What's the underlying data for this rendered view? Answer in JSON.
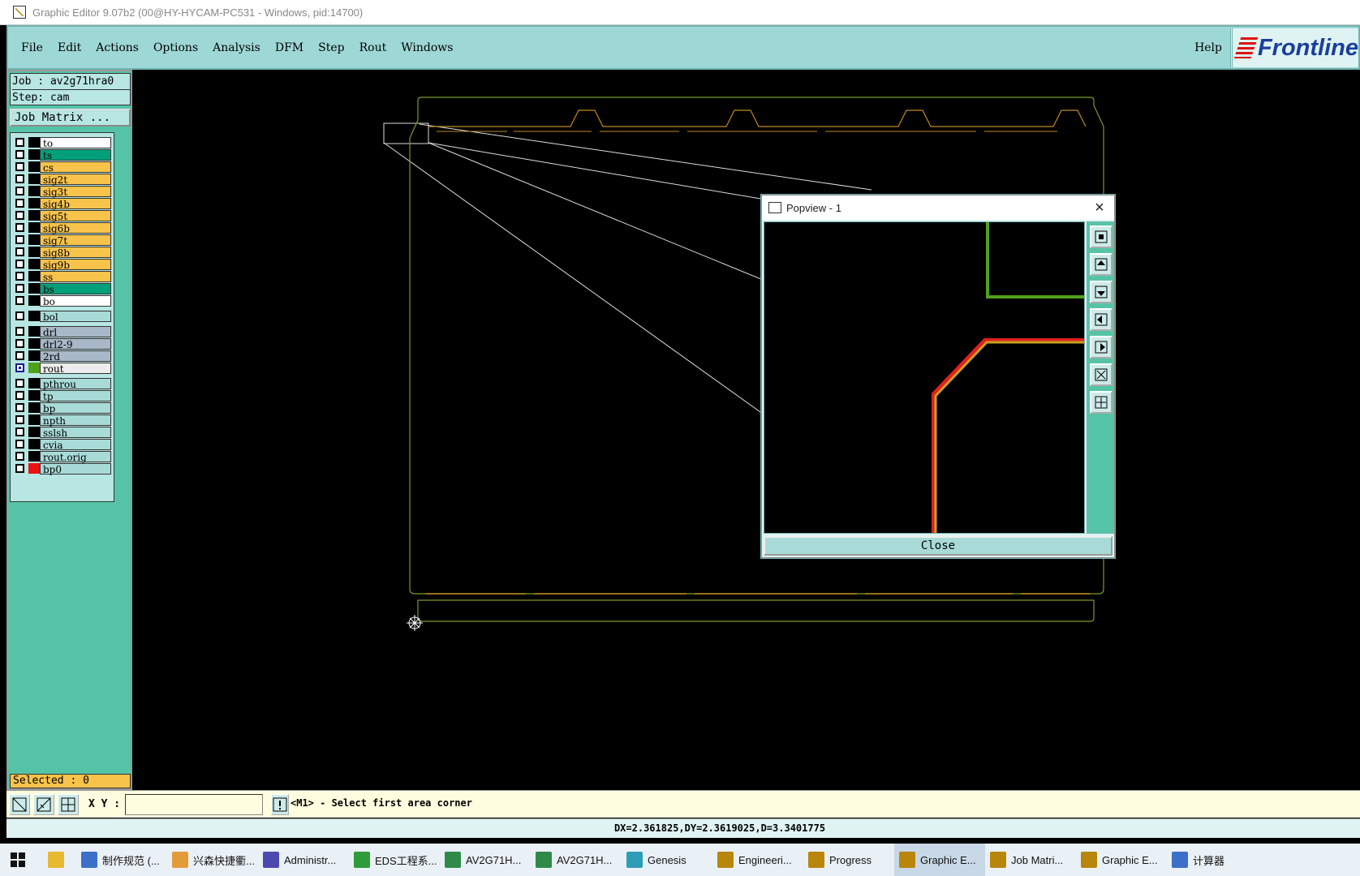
{
  "window": {
    "title": "Graphic Editor 9.07b2 (00@HY-HYCAM-PC531 - Windows, pid:14700)"
  },
  "menu": {
    "items": [
      "File",
      "Edit",
      "Actions",
      "Options",
      "Analysis",
      "DFM",
      "Step",
      "Rout",
      "Windows"
    ],
    "help": "Help",
    "logo": "Frontline"
  },
  "job": {
    "job_line": "Job : av2g71hra0",
    "step_line": "Step: cam",
    "matrix_button": "Job Matrix ..."
  },
  "layers": [
    {
      "name": "to",
      "color": "#ffffff"
    },
    {
      "name": "ts",
      "color": "#00a07a"
    },
    {
      "name": "cs",
      "color": "#f8c34a"
    },
    {
      "name": "sig2t",
      "color": "#f8c34a"
    },
    {
      "name": "sig3t",
      "color": "#f8c34a"
    },
    {
      "name": "sig4b",
      "color": "#f8c34a"
    },
    {
      "name": "sig5t",
      "color": "#f8c34a"
    },
    {
      "name": "sig6b",
      "color": "#f8c34a"
    },
    {
      "name": "sig7t",
      "color": "#f8c34a"
    },
    {
      "name": "sig8b",
      "color": "#f8c34a"
    },
    {
      "name": "sig9b",
      "color": "#f8c34a"
    },
    {
      "name": "ss",
      "color": "#f8c34a"
    },
    {
      "name": "bs",
      "color": "#00a07a"
    },
    {
      "name": "bo",
      "color": "#ffffff"
    },
    {
      "name": "bol",
      "color": "#a8dbd8"
    },
    {
      "name": "drl",
      "color": "#a8b8c8"
    },
    {
      "name": "drl2-9",
      "color": "#a8b8c8"
    },
    {
      "name": "2rd",
      "color": "#a8b8c8"
    },
    {
      "name": "rout",
      "color": "#ececec",
      "active": true,
      "swatch": "#4fa11a"
    },
    {
      "name": "pthrou",
      "color": "#a8dbd8"
    },
    {
      "name": "tp",
      "color": "#a8dbd8"
    },
    {
      "name": "bp",
      "color": "#a8dbd8"
    },
    {
      "name": "npth",
      "color": "#a8dbd8"
    },
    {
      "name": "sslsh",
      "color": "#a8dbd8"
    },
    {
      "name": "cvia",
      "color": "#a8dbd8"
    },
    {
      "name": "rout.orig",
      "color": "#a8dbd8"
    },
    {
      "name": "bp0",
      "color": "#a8dbd8",
      "swatch": "#ee1111"
    }
  ],
  "selected_text": "Selected : 0",
  "status": {
    "xy_label": "X Y :",
    "prompt": "<M1> - Select first area corner",
    "coords": "DX=2.361825,DY=2.3619025,D=3.3401775"
  },
  "popview": {
    "title": "Popview - 1",
    "close_label": "Close"
  },
  "taskbar": [
    {
      "label": "制作规范 (...",
      "color": "#3b6fc9"
    },
    {
      "label": "兴森快捷衢...",
      "color": "#e39b3a"
    },
    {
      "label": "Administr...",
      "color": "#4a4ab0"
    },
    {
      "label": "EDS工程系...",
      "color": "#2f9b3a"
    },
    {
      "label": "AV2G71H...",
      "color": "#2f8a4a"
    },
    {
      "label": "AV2G71H...",
      "color": "#2f8a4a"
    },
    {
      "label": "Genesis",
      "color": "#2e9db8"
    },
    {
      "label": "Engineeri...",
      "color": "#b8860b"
    },
    {
      "label": "Progress",
      "color": "#b8860b"
    },
    {
      "label": "Graphic E...",
      "color": "#b8860b",
      "active": true
    },
    {
      "label": "Job Matri...",
      "color": "#b8860b"
    },
    {
      "label": "Graphic E...",
      "color": "#b8860b"
    },
    {
      "label": "计算器",
      "color": "#3b6fc9"
    }
  ]
}
